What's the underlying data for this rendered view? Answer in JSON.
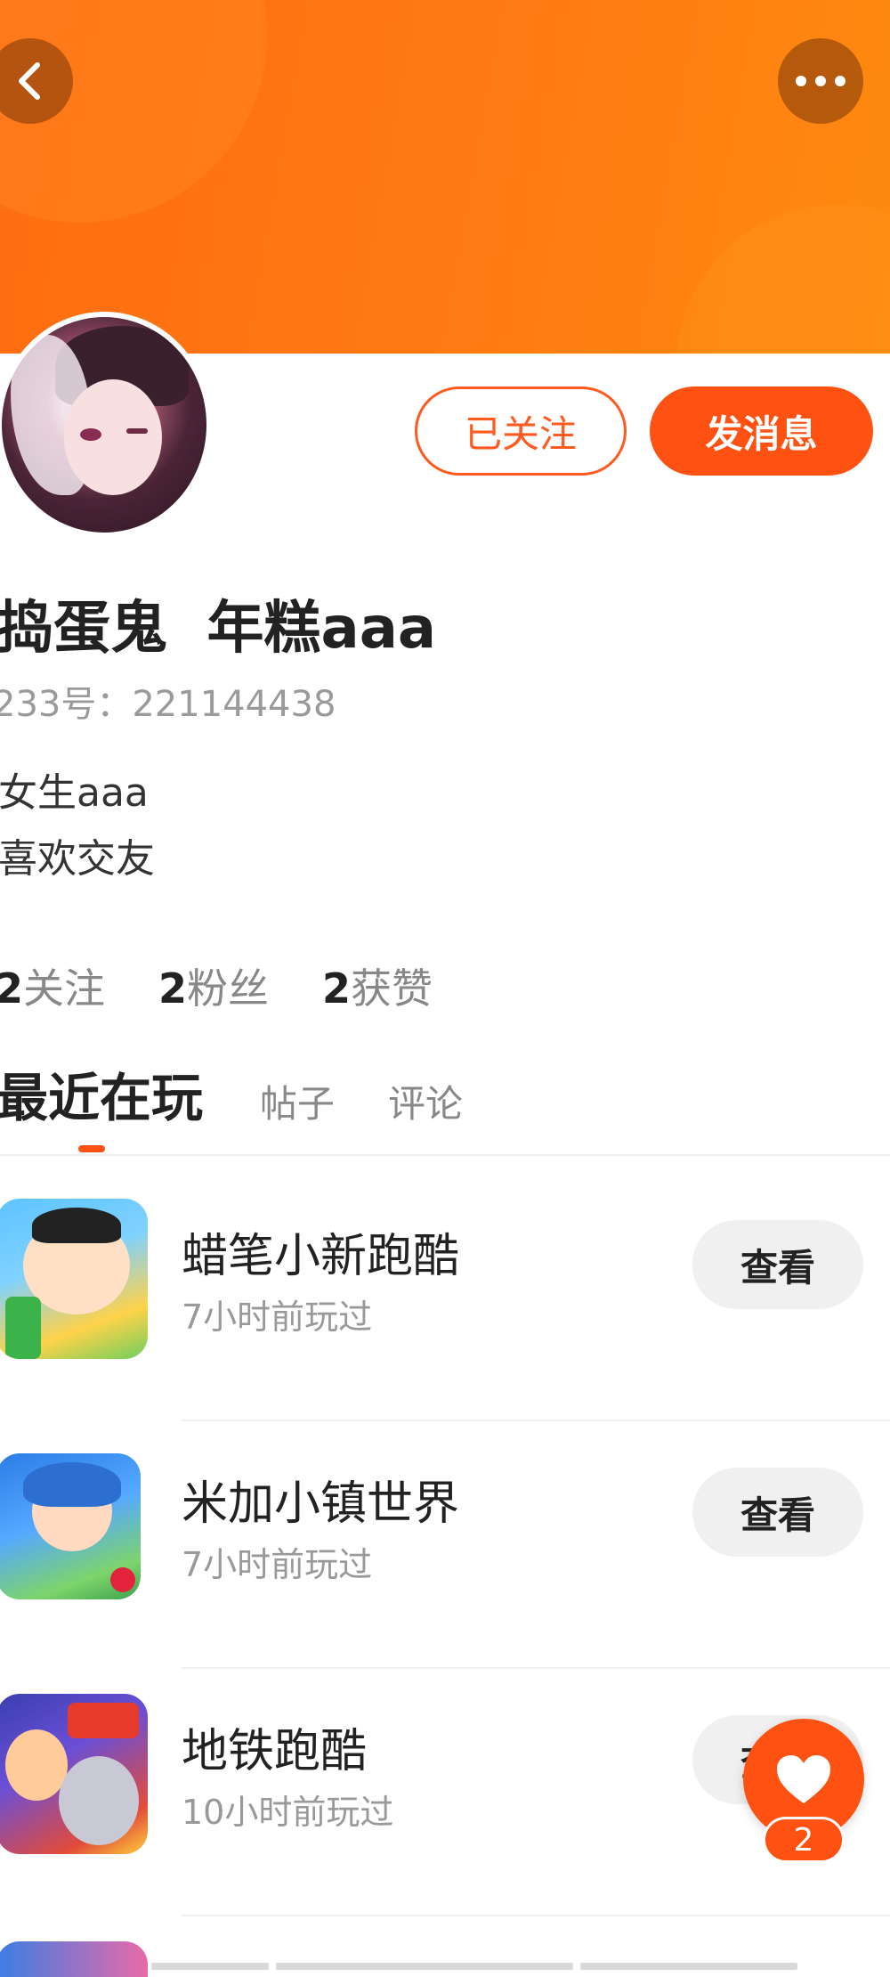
{
  "header": {
    "back_icon": "chevron-left-icon",
    "more_icon": "more-dots-icon",
    "banner_color": "#ff7a12"
  },
  "profile": {
    "followed_label": "已关注",
    "message_label": "发消息",
    "username": "捣蛋鬼  年糕aaa",
    "user_id": "233号：221144438",
    "bio_lines": [
      "女生aaa",
      "喜欢交友"
    ],
    "stats": [
      {
        "num": "2",
        "label": "关注"
      },
      {
        "num": "2",
        "label": "粉丝"
      },
      {
        "num": "2",
        "label": "获赞"
      }
    ]
  },
  "tabs": {
    "active": "最近在玩",
    "posts": "帖子",
    "comments": "评论"
  },
  "games": [
    {
      "title": "蜡笔小新跑酷",
      "time": "7小时前玩过",
      "button": "查看"
    },
    {
      "title": "米加小镇世界",
      "time": "7小时前玩过",
      "button": "查看"
    },
    {
      "title": "地铁跑酷",
      "time": "10小时前玩过",
      "button": "查看"
    }
  ],
  "floating": {
    "like_count": "2",
    "accent": "#ff5212"
  }
}
